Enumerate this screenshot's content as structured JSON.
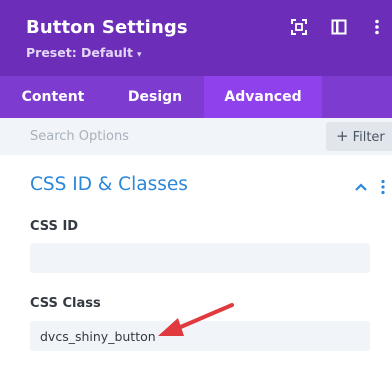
{
  "header": {
    "title": "Button Settings",
    "preset": "Preset: Default",
    "background_color": "#6c2eb9",
    "icons": [
      "focus-icon",
      "sidebar-toggle-icon",
      "more-vertical-icon"
    ]
  },
  "tabs": [
    {
      "label": "Content",
      "active": false
    },
    {
      "label": "Design",
      "active": false
    },
    {
      "label": "Advanced",
      "active": true
    }
  ],
  "search": {
    "placeholder": "Search Options",
    "value": "",
    "filter_label": "Filter"
  },
  "section": {
    "title": "CSS ID & Classes",
    "title_color": "#2b87da",
    "expanded": true
  },
  "fields": {
    "css_id": {
      "label": "CSS ID",
      "value": ""
    },
    "css_class": {
      "label": "CSS Class",
      "value": "dvcs_shiny_button"
    }
  },
  "annotation": {
    "arrow_color": "#e0393e",
    "points_to": "css_class"
  }
}
